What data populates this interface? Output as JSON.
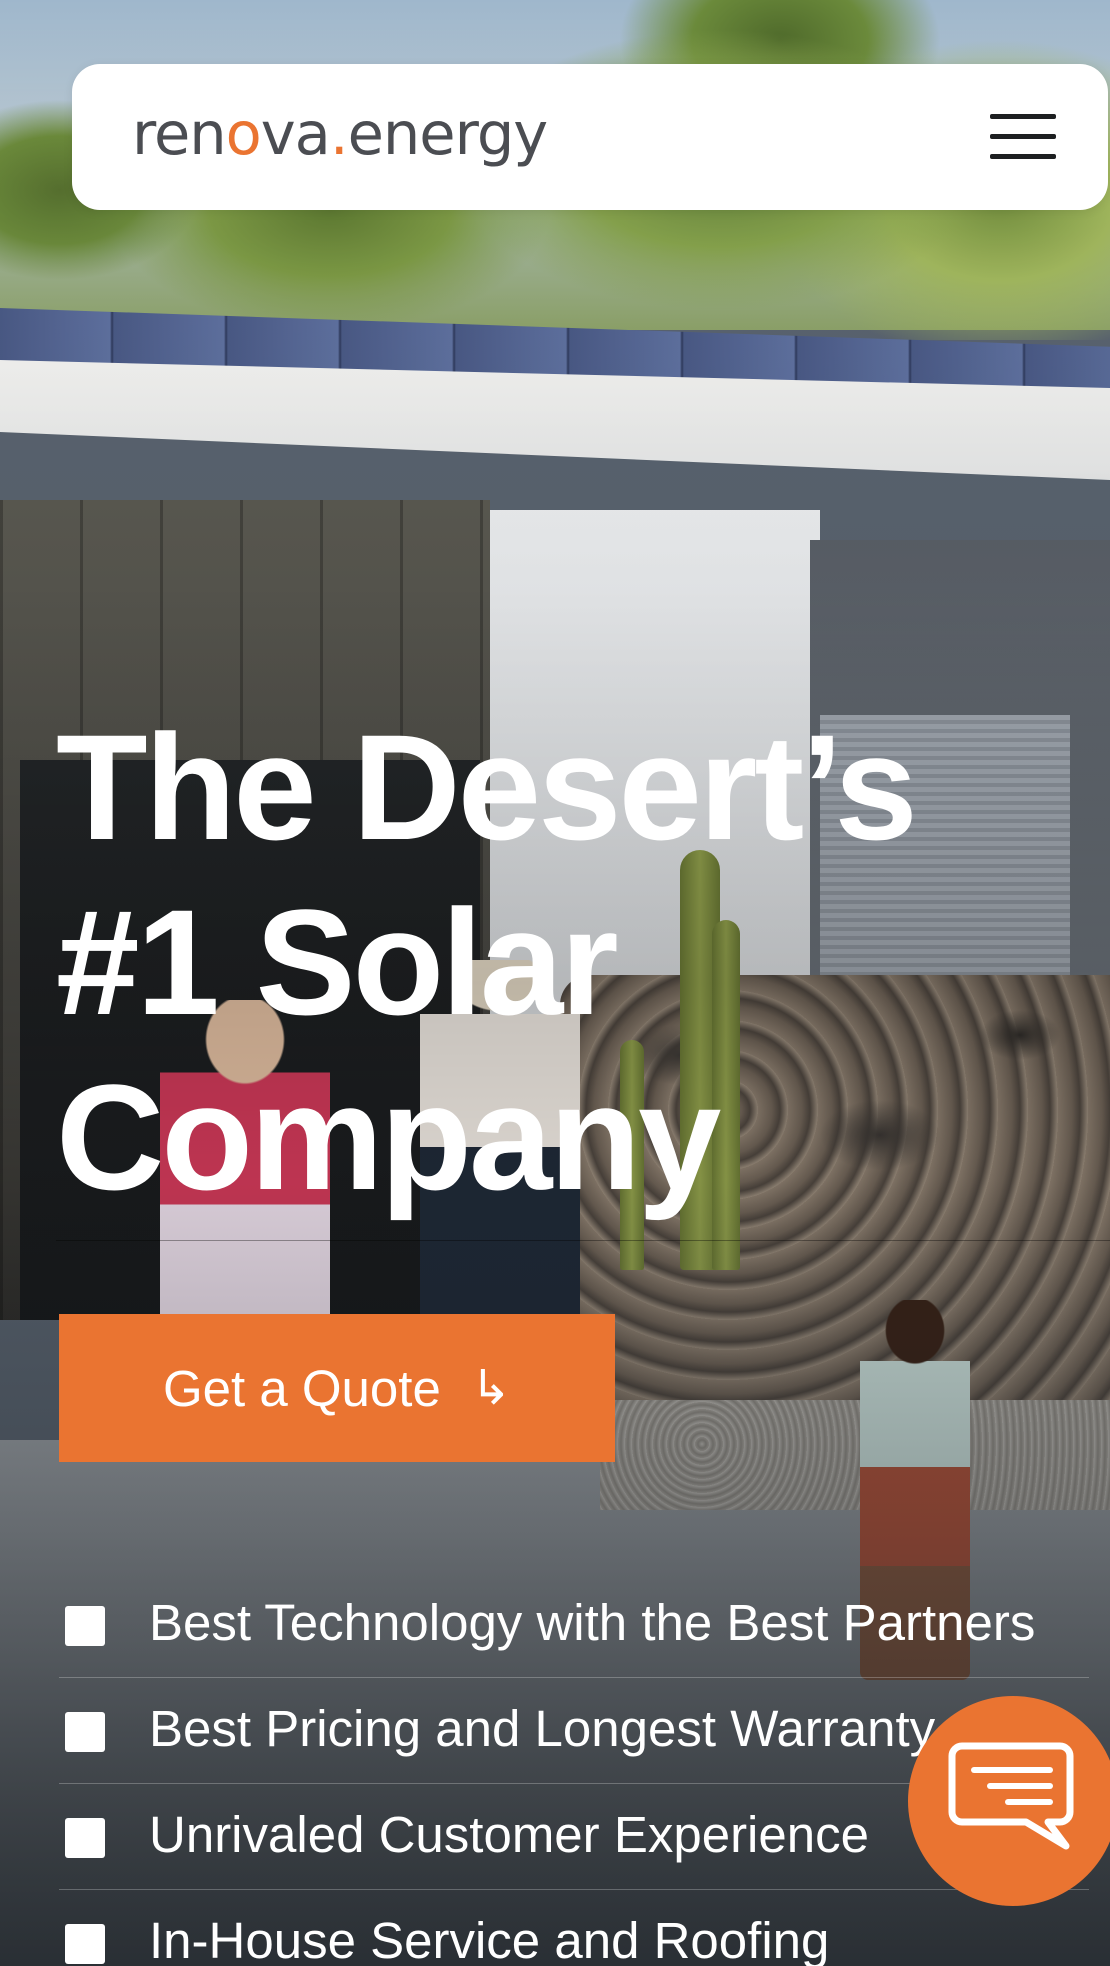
{
  "brand": {
    "logo_prefix": "ren",
    "logo_o": "o",
    "logo_middle": "va",
    "logo_dot": ".",
    "logo_suffix": "energy",
    "accent_color": "#ea7431",
    "logo_text_color": "#4b4d52"
  },
  "header": {
    "menu_icon": "hamburger-menu-icon"
  },
  "hero": {
    "headline_line1": "The Desert’s",
    "headline_line2": "#1 Solar",
    "headline_line3": "Company",
    "cta_label": "Get a Quote",
    "cta_arrow": "↳",
    "cta_icon": "arrow-return-right-icon",
    "benefits": [
      {
        "label": "Best Technology with the Best Partners",
        "icon": "checkbox-icon"
      },
      {
        "label": "Best Pricing and Longest Warranty",
        "icon": "checkbox-icon"
      },
      {
        "label": "Unrivaled Customer Experience",
        "icon": "checkbox-icon"
      },
      {
        "label": "In-House Service and Roofing",
        "icon": "checkbox-icon"
      }
    ]
  },
  "chat": {
    "icon": "chat-bubble-icon"
  }
}
